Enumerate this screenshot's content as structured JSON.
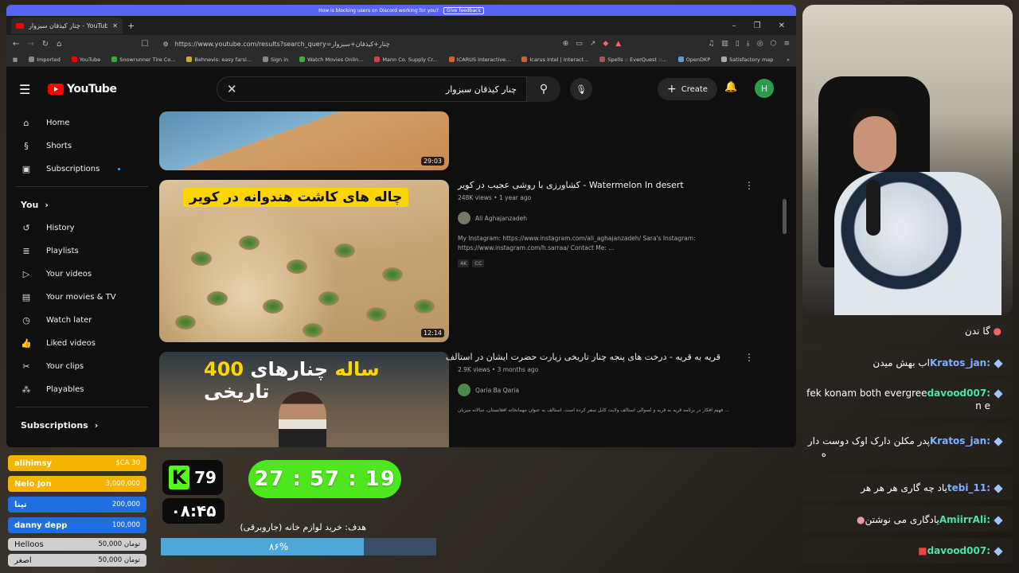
{
  "browser": {
    "banner_text": "How is blocking users on Discord working for you?",
    "banner_button": "Give feedback",
    "tab_title": "چنار کیذقان سبزوار - YouTube",
    "url": "https://www.youtube.com/results?search_query=چنار+کیذقان+سبزوار",
    "bookmarks": [
      "Imported",
      "YouTube",
      "Snowrunner Tire Co...",
      "Behnevis: easy farsi...",
      "Sign in",
      "Watch Movies Onlin...",
      "Mann Co. Supply Cr...",
      "ICARUS Interactive...",
      "Icarus Intel | Interact...",
      "Spells :: EverQuest ::...",
      "OpenDKP",
      "Satisfactory map"
    ]
  },
  "youtube": {
    "logo": "YouTube",
    "search_value": "چنار کیذقان سبزوار",
    "create_label": "Create",
    "avatar_letter": "H",
    "sidebar": {
      "main": [
        "Home",
        "Shorts",
        "Subscriptions"
      ],
      "you_label": "You",
      "you_items": [
        "History",
        "Playlists",
        "Your videos",
        "Your movies & TV",
        "Watch later",
        "Liked videos",
        "Your clips",
        "Playables"
      ],
      "subs_label": "Subscriptions"
    },
    "results": [
      {
        "duration": "29:03"
      },
      {
        "duration": "12:14",
        "thumb_text": "چاله های کاشت هندوانه در کویر",
        "title": "کشاورزی با روشی عجیب در کویر - Watermelon In desert",
        "meta": "248K views • 1 year ago",
        "channel": "Ali Aghajanzadeh",
        "desc_1": "My Instagram: https://www.instagram.com/ali_aghajanzadeh/ Sara's Instagram:",
        "desc_2": "https://www.instagram.com/h.sarraa/ Contact Me: ...",
        "badge_1": "4K",
        "badge_2": "CC"
      },
      {
        "thumb_text_a": "چنارهای تاریخی ",
        "thumb_text_b": "400 ساله",
        "title": "قریه به قریه - درخت های پنجه چنار تاریخی زیارت حضرت ایشان در استالف",
        "meta": "2.9K views • 3 months ago",
        "channel": "Qaria Ba Qaria",
        "desc": "... فهیم افکار در برنامه قریه به قریه و لسوالی استالف ولایت کابل سفر کرده است. استالف به عنوان مهمانخانه افغانستان، سالانه میزبان"
      }
    ]
  },
  "chat": [
    {
      "user": "",
      "text": "گا ندن"
    },
    {
      "user": "Kratos_jan:",
      "text": "اب بهش میدن"
    },
    {
      "user": "davood007:",
      "text": "fek konam both evergree",
      "text2": "n e"
    },
    {
      "user": "Kratos_jan:",
      "text": "پدر مکلن دارک اوک دوست دار",
      "text2": "ه"
    },
    {
      "user": "tebi_11:",
      "text": "یاد چه گاری هر هر هر"
    },
    {
      "user": "AmiirrAli:",
      "text": "یادگاری می نوشتن"
    },
    {
      "user": "davood007:",
      "text": ""
    }
  ],
  "donors": [
    {
      "name": "alihimsy",
      "amount": "$CA 30",
      "color": "#f5b400"
    },
    {
      "name": "Nelo Jon",
      "amount": "3,000,000",
      "color": "#f5b400"
    },
    {
      "name": "تینا",
      "amount": "200,000",
      "color": "#1f6fe0"
    },
    {
      "name": "danny depp",
      "amount": "100,000",
      "color": "#1f6fe0"
    },
    {
      "name": "Helloos",
      "amount": "50,000 تومان"
    },
    {
      "name": "اصغر",
      "amount": "50,000 تومان"
    }
  ],
  "overlay": {
    "kick_count": "79",
    "clock": "۰۸:۴۵",
    "timer": "27 : 57 : 19",
    "goal_label": "هدف: خرید لوازم خانه (جاروبرقی)",
    "goal_pct_text": "۸۶%",
    "goal_fraction": 0.86,
    "accent_kick": "#53fc18",
    "accent_timer": "#4ee61c"
  }
}
